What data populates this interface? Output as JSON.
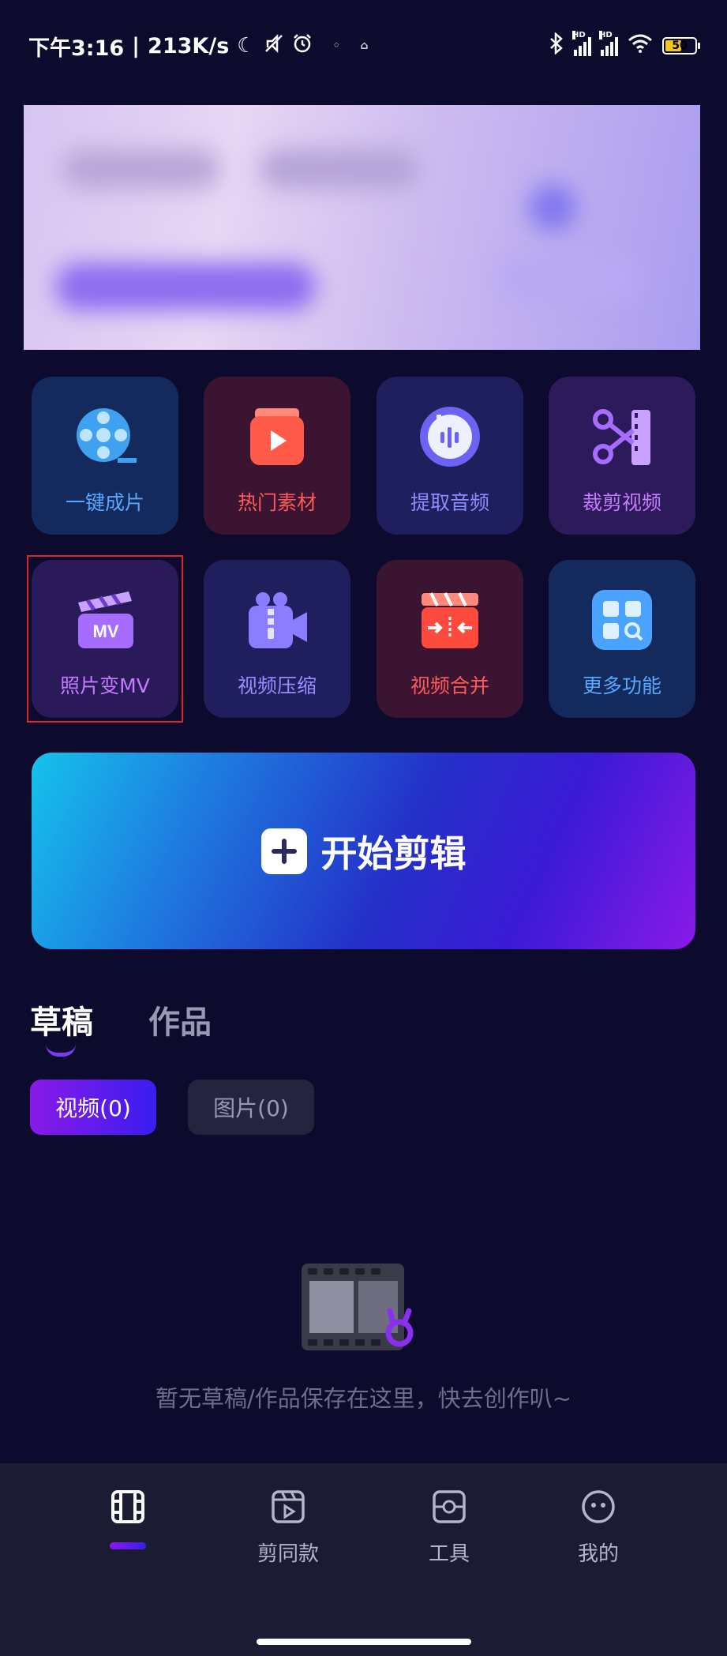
{
  "status_bar": {
    "time": "下午3:16",
    "net_speed": "213K/s",
    "battery": "50"
  },
  "tools": [
    {
      "label": "一键成片",
      "color": "#58a8ff",
      "bg": "#142a5c",
      "icon": "film-reel-icon"
    },
    {
      "label": "热门素材",
      "color": "#ff5a5a",
      "bg": "#3a1430",
      "icon": "play-stack-icon"
    },
    {
      "label": "提取音频",
      "color": "#8c8cff",
      "bg": "#1e1f5c",
      "icon": "audio-wave-icon"
    },
    {
      "label": "裁剪视频",
      "color": "#c57cff",
      "bg": "#2d1a5a",
      "icon": "scissors-film-icon"
    },
    {
      "label": "照片变MV",
      "color": "#c57cff",
      "bg": "#2a1a5a",
      "icon": "clapper-mv-icon"
    },
    {
      "label": "视频压缩",
      "color": "#9a8cff",
      "bg": "#1e1f5c",
      "icon": "zip-camera-icon"
    },
    {
      "label": "视频合并",
      "color": "#ff5a5a",
      "bg": "#3a1430",
      "icon": "merge-clapper-icon"
    },
    {
      "label": "更多功能",
      "color": "#58a8ff",
      "bg": "#142a5c",
      "icon": "grid-search-icon"
    }
  ],
  "start_edit": {
    "label": "开始剪辑"
  },
  "tabs": {
    "drafts": "草稿",
    "works": "作品"
  },
  "chips": {
    "video": "视频(0)",
    "image": "图片(0)"
  },
  "empty": {
    "text": "暂无草稿/作品保存在这里，快去创作叭~"
  },
  "nav": {
    "items": [
      {
        "label": "",
        "icon": "film-grid-icon"
      },
      {
        "label": "剪同款",
        "icon": "template-play-icon"
      },
      {
        "label": "工具",
        "icon": "toolbox-icon"
      },
      {
        "label": "我的",
        "icon": "profile-face-icon"
      }
    ]
  }
}
